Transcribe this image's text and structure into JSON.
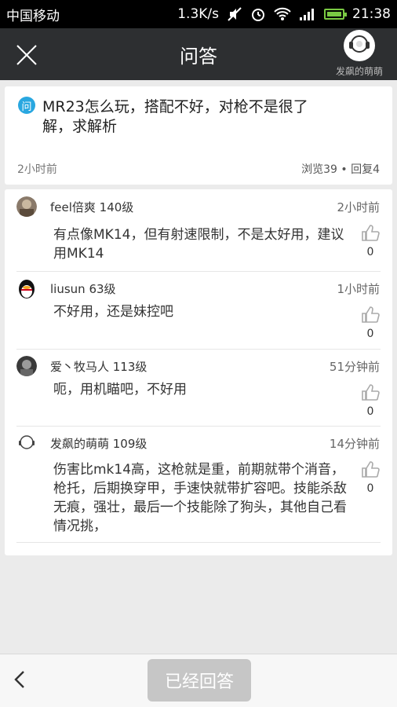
{
  "statusbar": {
    "carrier": "中国移动",
    "speed": "1.3K/s",
    "time": "21:38"
  },
  "topbar": {
    "title": "问答",
    "username": "发飙的萌萌",
    "icons": [
      "close-icon",
      "user-avatar"
    ]
  },
  "question": {
    "badge": "问",
    "text": "MR23怎么玩，搭配不好，对枪不是很了解，求解析",
    "time": "2小时前",
    "stats": "浏览39 • 回复4"
  },
  "answers": [
    {
      "name": "feel倍爽  140级",
      "time": "2小时前",
      "content": "有点像MK14，但有射速限制，不是太好用，建议用MK14",
      "likes": "0"
    },
    {
      "name": "liusun  63级",
      "time": "1小时前",
      "content": "不好用，还是妹控吧",
      "likes": "0"
    },
    {
      "name": "爱丶牧马人  113级",
      "time": "51分钟前",
      "content": "呃，用机瞄吧，不好用",
      "likes": "0"
    },
    {
      "name": "发飙的萌萌  109级",
      "time": "14分钟前",
      "content": "伤害比mk14高，这枪就是重，前期就带个消音，枪托，后期换穿甲，手速快就带扩容吧。技能杀敌无痕，强壮，最后一个技能除了狗头，其他自己看情况挑，",
      "likes": "0"
    }
  ],
  "bottombar": {
    "button_label": "已经回答"
  },
  "colors": {
    "topbar_bg": "#2d2f31",
    "badge": "#29a7e0",
    "battery": "#7ac943",
    "button_disabled": "#c6c6c6"
  }
}
